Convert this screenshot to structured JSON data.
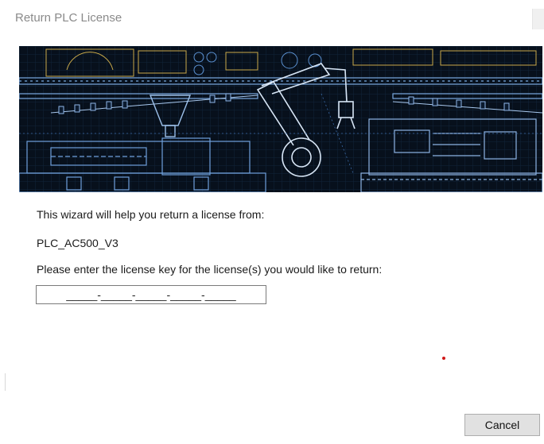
{
  "window": {
    "title": "Return PLC License"
  },
  "banner": {
    "image": "industrial-machinery-blueprint",
    "colors": {
      "background": "#07101c",
      "lines": "#4a8bd6",
      "accent": "#d6b04a"
    }
  },
  "content": {
    "intro": "This wizard will help you return a license from:",
    "device_name": "PLC_AC500_V3",
    "prompt": "Please enter the license key for the license(s) you would like to return:"
  },
  "license_key": {
    "mask": "_____-_____-_____-_____-_____",
    "value": ""
  },
  "buttons": {
    "cancel": "Cancel"
  }
}
